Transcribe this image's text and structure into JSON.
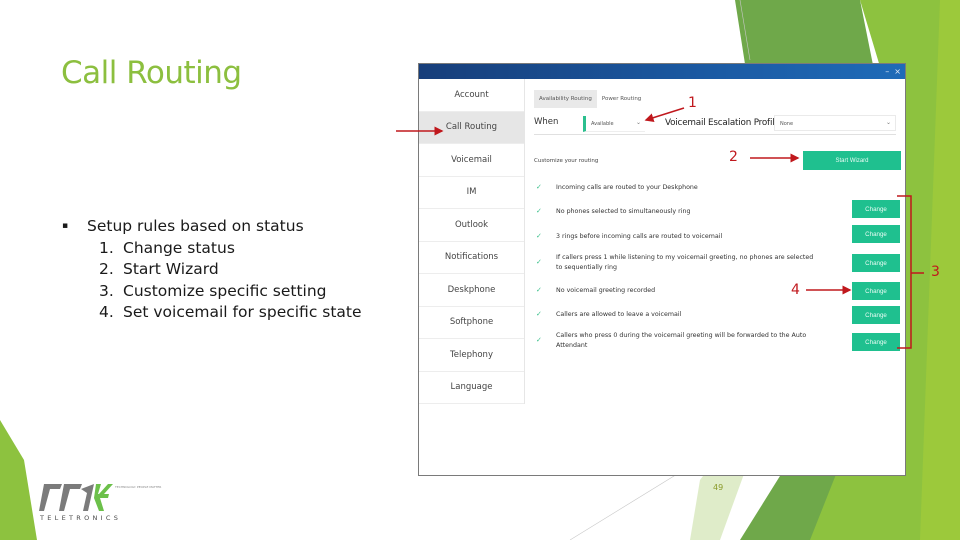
{
  "slide": {
    "title": "Call Routing",
    "bullet": "Setup rules based on status",
    "bullet_marker": "▪",
    "steps": [
      {
        "num": "1.",
        "text": "Change status"
      },
      {
        "num": "2.",
        "text": "Start Wizard"
      },
      {
        "num": "3.",
        "text": "Customize specific setting"
      },
      {
        "num": "4.",
        "text": "Set voicemail for specific state"
      }
    ],
    "page_number": "49",
    "accent_color": "#8cbf3f"
  },
  "logo": {
    "brand": "TTX",
    "name": "TELETRONICS",
    "tagline": "TECHNOLOGY. PEOPLE MATTER"
  },
  "window": {
    "controls": {
      "minimize": "–",
      "close": "×"
    },
    "sidebar": {
      "items": [
        {
          "label": "Account",
          "active": false
        },
        {
          "label": "Call Routing",
          "active": true
        },
        {
          "label": "Voicemail",
          "active": false
        },
        {
          "label": "IM",
          "active": false
        },
        {
          "label": "Outlook",
          "active": false
        },
        {
          "label": "Notifications",
          "active": false
        },
        {
          "label": "Deskphone",
          "active": false
        },
        {
          "label": "Softphone",
          "active": false
        },
        {
          "label": "Telephony",
          "active": false
        },
        {
          "label": "Language",
          "active": false
        }
      ]
    },
    "tabs": [
      {
        "label": "Availability Routing",
        "active": true
      },
      {
        "label": "Power Routing",
        "active": false
      }
    ],
    "when_label": "When",
    "status_select": {
      "value": "Available",
      "chevron": "⌄"
    },
    "escalation_label": "Voicemail Escalation Profile",
    "escalation_select": {
      "value": "None",
      "chevron": "⌄"
    },
    "customize_label": "Customize your routing",
    "wizard_button": "Start Wizard",
    "rules": [
      {
        "text": "Incoming calls are routed to your Deskphone",
        "button": null
      },
      {
        "text": "No phones selected to simultaneously ring",
        "button": "Change"
      },
      {
        "text": "3 rings before incoming calls are routed to voicemail",
        "button": "Change"
      },
      {
        "text": "If callers press 1 while listening to my voicemail greeting, no phones are selected to sequentially ring",
        "button": "Change"
      },
      {
        "text": "No voicemail greeting recorded",
        "button": "Change"
      },
      {
        "text": "Callers are allowed to leave a voicemail",
        "button": "Change"
      },
      {
        "text": "Callers who press 0 during the voicemail greeting will be forwarded to the Auto Attendant",
        "button": "Change"
      }
    ],
    "check_glyph": "✓",
    "button_color": "#1fc08f"
  },
  "annotations": {
    "labels": [
      "1",
      "2",
      "3",
      "4"
    ],
    "color": "#c0181d"
  }
}
